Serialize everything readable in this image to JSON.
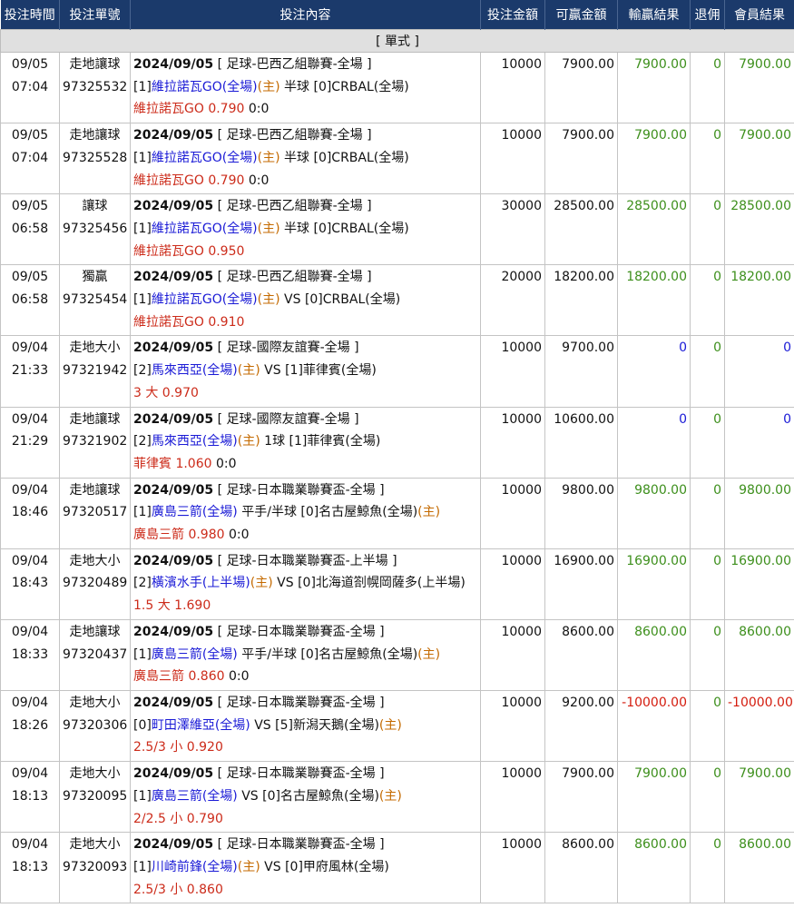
{
  "headers": {
    "time": "投注時間",
    "order": "投注單號",
    "content": "投注內容",
    "amount": "投注金額",
    "win": "可贏金額",
    "result": "輸贏結果",
    "rebate": "退佣",
    "member": "會員結果"
  },
  "section": "[ 單式 ]",
  "colors": {
    "header_bg": "#1b3a6b",
    "team": "#1a1ad6",
    "home_tag": "#c46a00",
    "pick": "#cc2b1a",
    "win": "#3d8f1c",
    "zero": "#1a1ad6",
    "loss": "#d41c0e"
  },
  "rows": [
    {
      "date": "09/05",
      "time": "07:04",
      "type": "走地讓球",
      "order": "97325532",
      "line1_bold": "2024/09/05",
      "line1_rest": " [ 足球-巴西乙組聯賽-全場 ]",
      "l2": [
        {
          "t": "[1]",
          "c": ""
        },
        {
          "t": "維拉諾瓦GO(全場)",
          "c": "blue"
        },
        {
          "t": "(主)",
          "c": "orange"
        },
        {
          "t": " 半球 [0]CRBAL(全場)",
          "c": ""
        }
      ],
      "l3": [
        {
          "t": "維拉諾瓦GO 0.790",
          "c": "red"
        },
        {
          "t": " 0:0",
          "c": ""
        }
      ],
      "amount": "10000",
      "win": "7900.00",
      "result": "7900.00",
      "result_class": "green",
      "rebate": "0",
      "member": "7900.00",
      "member_class": "green"
    },
    {
      "date": "09/05",
      "time": "07:04",
      "type": "走地讓球",
      "order": "97325528",
      "line1_bold": "2024/09/05",
      "line1_rest": " [ 足球-巴西乙組聯賽-全場 ]",
      "l2": [
        {
          "t": "[1]",
          "c": ""
        },
        {
          "t": "維拉諾瓦GO(全場)",
          "c": "blue"
        },
        {
          "t": "(主)",
          "c": "orange"
        },
        {
          "t": " 半球 [0]CRBAL(全場)",
          "c": ""
        }
      ],
      "l3": [
        {
          "t": "維拉諾瓦GO 0.790",
          "c": "red"
        },
        {
          "t": " 0:0",
          "c": ""
        }
      ],
      "amount": "10000",
      "win": "7900.00",
      "result": "7900.00",
      "result_class": "green",
      "rebate": "0",
      "member": "7900.00",
      "member_class": "green"
    },
    {
      "date": "09/05",
      "time": "06:58",
      "type": "讓球",
      "order": "97325456",
      "line1_bold": "2024/09/05",
      "line1_rest": " [ 足球-巴西乙組聯賽-全場 ]",
      "l2": [
        {
          "t": "[1]",
          "c": ""
        },
        {
          "t": "維拉諾瓦GO(全場)",
          "c": "blue"
        },
        {
          "t": "(主)",
          "c": "orange"
        },
        {
          "t": " 半球 [0]CRBAL(全場)",
          "c": ""
        }
      ],
      "l3": [
        {
          "t": "維拉諾瓦GO 0.950",
          "c": "red"
        }
      ],
      "amount": "30000",
      "win": "28500.00",
      "result": "28500.00",
      "result_class": "green",
      "rebate": "0",
      "member": "28500.00",
      "member_class": "green"
    },
    {
      "date": "09/05",
      "time": "06:58",
      "type": "獨贏",
      "order": "97325454",
      "line1_bold": "2024/09/05",
      "line1_rest": " [ 足球-巴西乙組聯賽-全場 ]",
      "l2": [
        {
          "t": "[1]",
          "c": ""
        },
        {
          "t": "維拉諾瓦GO(全場)",
          "c": "blue"
        },
        {
          "t": "(主)",
          "c": "orange"
        },
        {
          "t": " VS [0]CRBAL(全場)",
          "c": ""
        }
      ],
      "l3": [
        {
          "t": "維拉諾瓦GO 0.910",
          "c": "red"
        }
      ],
      "amount": "20000",
      "win": "18200.00",
      "result": "18200.00",
      "result_class": "green",
      "rebate": "0",
      "member": "18200.00",
      "member_class": "green"
    },
    {
      "date": "09/04",
      "time": "21:33",
      "type": "走地大小",
      "order": "97321942",
      "line1_bold": "2024/09/05",
      "line1_rest": " [ 足球-國際友誼賽-全場 ]",
      "l2": [
        {
          "t": "[2]",
          "c": ""
        },
        {
          "t": "馬來西亞(全場)",
          "c": "blue"
        },
        {
          "t": "(主)",
          "c": "orange"
        },
        {
          "t": " VS [1]菲律賓(全場)",
          "c": ""
        }
      ],
      "l3": [
        {
          "t": "3 大 0.970",
          "c": "red"
        }
      ],
      "amount": "10000",
      "win": "9700.00",
      "result": "0",
      "result_class": "zero",
      "rebate": "0",
      "member": "0",
      "member_class": "zero"
    },
    {
      "date": "09/04",
      "time": "21:29",
      "type": "走地讓球",
      "order": "97321902",
      "line1_bold": "2024/09/05",
      "line1_rest": " [ 足球-國際友誼賽-全場 ]",
      "l2": [
        {
          "t": "[2]",
          "c": ""
        },
        {
          "t": "馬來西亞(全場)",
          "c": "blue"
        },
        {
          "t": "(主)",
          "c": "orange"
        },
        {
          "t": " 1球 [1]菲律賓(全場)",
          "c": ""
        }
      ],
      "l3": [
        {
          "t": "菲律賓 1.060",
          "c": "red"
        },
        {
          "t": " 0:0",
          "c": ""
        }
      ],
      "amount": "10000",
      "win": "10600.00",
      "result": "0",
      "result_class": "zero",
      "rebate": "0",
      "member": "0",
      "member_class": "zero"
    },
    {
      "date": "09/04",
      "time": "18:46",
      "type": "走地讓球",
      "order": "97320517",
      "line1_bold": "2024/09/05",
      "line1_rest": " [ 足球-日本職業聯賽盃-全場 ]",
      "l2": [
        {
          "t": "[1]",
          "c": ""
        },
        {
          "t": "廣島三箭(全場)",
          "c": "blue"
        },
        {
          "t": " 平手/半球 [0]名古屋鯨魚(全場)",
          "c": ""
        },
        {
          "t": "(主)",
          "c": "orange"
        }
      ],
      "l3": [
        {
          "t": "廣島三箭 0.980",
          "c": "red"
        },
        {
          "t": " 0:0",
          "c": ""
        }
      ],
      "amount": "10000",
      "win": "9800.00",
      "result": "9800.00",
      "result_class": "green",
      "rebate": "0",
      "member": "9800.00",
      "member_class": "green"
    },
    {
      "date": "09/04",
      "time": "18:43",
      "type": "走地大小",
      "order": "97320489",
      "line1_bold": "2024/09/05",
      "line1_rest": " [ 足球-日本職業聯賽盃-上半場 ]",
      "l2": [
        {
          "t": "[2]",
          "c": ""
        },
        {
          "t": "橫濱水手(上半場)",
          "c": "blue"
        },
        {
          "t": "(主)",
          "c": "orange"
        },
        {
          "t": " VS [0]北海道劄幌岡薩多(上半場)",
          "c": ""
        }
      ],
      "l3": [
        {
          "t": "1.5 大 1.690",
          "c": "red"
        }
      ],
      "amount": "10000",
      "win": "16900.00",
      "result": "16900.00",
      "result_class": "green",
      "rebate": "0",
      "member": "16900.00",
      "member_class": "green"
    },
    {
      "date": "09/04",
      "time": "18:33",
      "type": "走地讓球",
      "order": "97320437",
      "line1_bold": "2024/09/05",
      "line1_rest": " [ 足球-日本職業聯賽盃-全場 ]",
      "l2": [
        {
          "t": "[1]",
          "c": ""
        },
        {
          "t": "廣島三箭(全場)",
          "c": "blue"
        },
        {
          "t": " 平手/半球 [0]名古屋鯨魚(全場)",
          "c": ""
        },
        {
          "t": "(主)",
          "c": "orange"
        }
      ],
      "l3": [
        {
          "t": "廣島三箭 0.860",
          "c": "red"
        },
        {
          "t": " 0:0",
          "c": ""
        }
      ],
      "amount": "10000",
      "win": "8600.00",
      "result": "8600.00",
      "result_class": "green",
      "rebate": "0",
      "member": "8600.00",
      "member_class": "green"
    },
    {
      "date": "09/04",
      "time": "18:26",
      "type": "走地大小",
      "order": "97320306",
      "line1_bold": "2024/09/05",
      "line1_rest": " [ 足球-日本職業聯賽盃-全場 ]",
      "l2": [
        {
          "t": "[0]",
          "c": ""
        },
        {
          "t": "町田澤維亞(全場)",
          "c": "blue"
        },
        {
          "t": " VS [5]新潟天鵝(全場)",
          "c": ""
        },
        {
          "t": "(主)",
          "c": "orange"
        }
      ],
      "l3": [
        {
          "t": "2.5/3 小 0.920",
          "c": "red"
        }
      ],
      "amount": "10000",
      "win": "9200.00",
      "result": "-10000.00",
      "result_class": "neg",
      "rebate": "0",
      "member": "-10000.00",
      "member_class": "neg"
    },
    {
      "date": "09/04",
      "time": "18:13",
      "type": "走地大小",
      "order": "97320095",
      "line1_bold": "2024/09/05",
      "line1_rest": " [ 足球-日本職業聯賽盃-全場 ]",
      "l2": [
        {
          "t": "[1]",
          "c": ""
        },
        {
          "t": "廣島三箭(全場)",
          "c": "blue"
        },
        {
          "t": " VS [0]名古屋鯨魚(全場)",
          "c": ""
        },
        {
          "t": "(主)",
          "c": "orange"
        }
      ],
      "l3": [
        {
          "t": "2/2.5 小 0.790",
          "c": "red"
        }
      ],
      "amount": "10000",
      "win": "7900.00",
      "result": "7900.00",
      "result_class": "green",
      "rebate": "0",
      "member": "7900.00",
      "member_class": "green"
    },
    {
      "date": "09/04",
      "time": "18:13",
      "type": "走地大小",
      "order": "97320093",
      "line1_bold": "2024/09/05",
      "line1_rest": " [ 足球-日本職業聯賽盃-全場 ]",
      "l2": [
        {
          "t": "[1]",
          "c": ""
        },
        {
          "t": "川崎前鋒(全場)",
          "c": "blue"
        },
        {
          "t": "(主)",
          "c": "orange"
        },
        {
          "t": " VS [0]甲府風林(全場)",
          "c": ""
        }
      ],
      "l3": [
        {
          "t": "2.5/3 小 0.860",
          "c": "red"
        }
      ],
      "amount": "10000",
      "win": "8600.00",
      "result": "8600.00",
      "result_class": "green",
      "rebate": "0",
      "member": "8600.00",
      "member_class": "green"
    }
  ]
}
